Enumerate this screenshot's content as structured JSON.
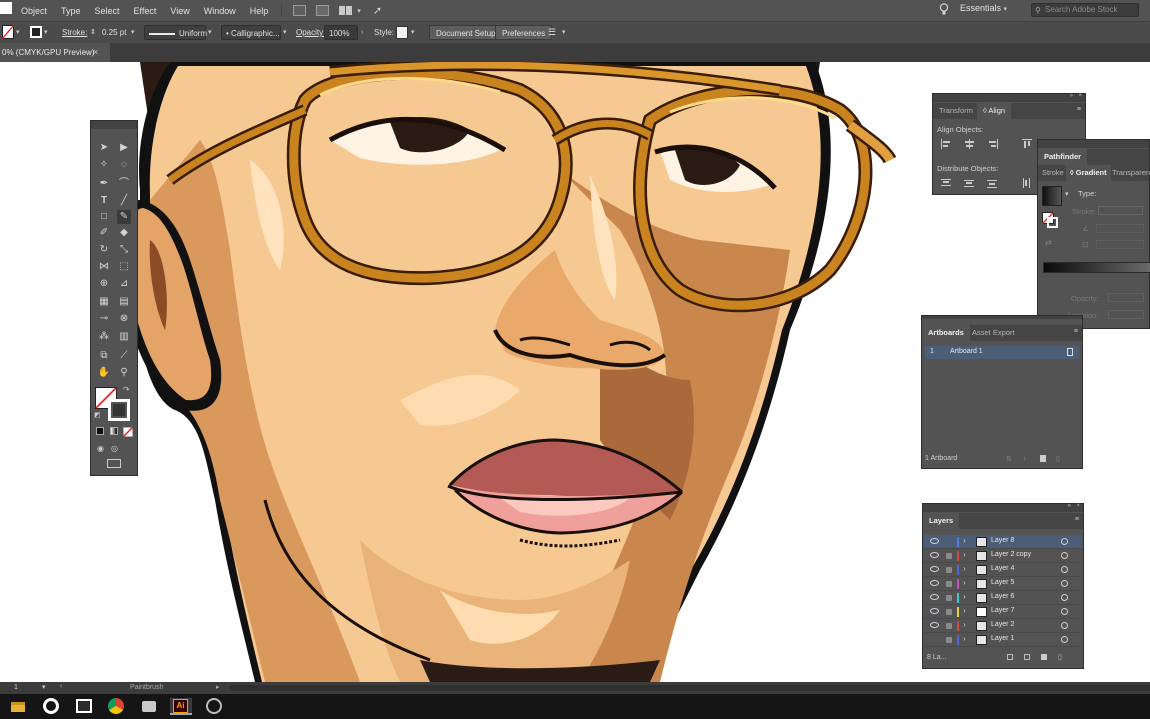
{
  "menubar": {
    "items": [
      "Object",
      "Type",
      "Select",
      "Effect",
      "View",
      "Window",
      "Help"
    ],
    "workspace": "Essentials",
    "search_placeholder": "Search Adobe Stock"
  },
  "controlbar": {
    "stroke_label": "Stroke:",
    "stroke_value": "0.25 pt",
    "profile_label": "Uniform",
    "brush_label": "Calligraphic...",
    "opacity_label": "Opacity:",
    "opacity_value": "100%",
    "style_label": "Style:",
    "document_setup_label": "Document Setup",
    "preferences_label": "Preferences"
  },
  "document_tab": {
    "title": "0% (CMYK/GPU Preview)",
    "close_glyph": "×"
  },
  "align_panel": {
    "tabs": [
      "Transform",
      "Align"
    ],
    "active_tab": "Align",
    "align_objects_label": "Align Objects:",
    "distribute_objects_label": "Distribute Objects:"
  },
  "gradient_panel": {
    "header_tab": "Pathfinder",
    "tabs": [
      "Stroke",
      "Gradient",
      "Transparen"
    ],
    "active_tab": "Gradient",
    "type_label": "Type:",
    "stroke_label": "Stroke:",
    "opacity_label": "Opacity:",
    "location_label": "Location:"
  },
  "artboards_panel": {
    "tabs": [
      "Artboards",
      "Asset Export"
    ],
    "active_tab": "Artboards",
    "rows": [
      {
        "index": "1",
        "name": "Artboard 1"
      }
    ],
    "footer": "1 Artboard"
  },
  "layers_panel": {
    "tab": "Layers",
    "layers": [
      {
        "name": "Layer 8",
        "color": "#4f7fd4",
        "selected": true
      },
      {
        "name": "Layer 2 copy",
        "color": "#d04848",
        "selected": false
      },
      {
        "name": "Layer 4",
        "color": "#4f64d4",
        "selected": false
      },
      {
        "name": "Layer 5",
        "color": "#c64fc6",
        "selected": false
      },
      {
        "name": "Layer 6",
        "color": "#3fc6cf",
        "selected": false
      },
      {
        "name": "Layer 7",
        "color": "#e0d23f",
        "selected": false
      },
      {
        "name": "Layer 2",
        "color": "#d04848",
        "selected": false
      },
      {
        "name": "Layer 1",
        "color": "#4f64d4",
        "selected": false
      }
    ],
    "footer": "8 La..."
  },
  "statusbar": {
    "zoom": "1",
    "tool": "Paintbrush"
  },
  "taskbar": {
    "icons": [
      "file-explorer-icon",
      "cortana-icon",
      "photos-icon",
      "chrome-icon",
      "network-icon",
      "illustrator-icon",
      "settings-icon"
    ]
  },
  "colors": {
    "ui_dark": "#535353",
    "selection": "#4b5d77",
    "illustrator_orange": "#ff9a00",
    "skin": "#f6c992",
    "frame_gold": "#c98420"
  }
}
